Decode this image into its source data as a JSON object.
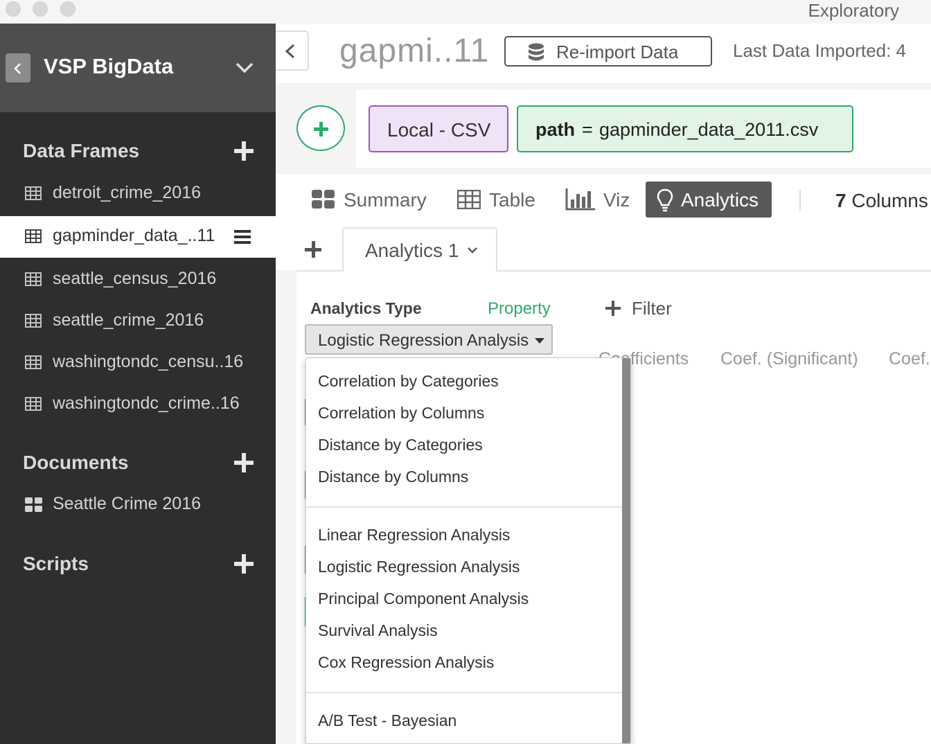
{
  "window": {
    "app_title": "Exploratory"
  },
  "sidebar": {
    "project_name": "VSP BigData",
    "sections": {
      "data_frames": "Data Frames",
      "documents": "Documents",
      "scripts": "Scripts"
    },
    "data_frames": [
      {
        "label": "detroit_crime_2016",
        "active": false
      },
      {
        "label": "gapminder_data_..11",
        "active": true
      },
      {
        "label": "seattle_census_2016",
        "active": false
      },
      {
        "label": "seattle_crime_2016",
        "active": false
      },
      {
        "label": "washingtondc_censu..16",
        "active": false
      },
      {
        "label": "washingtondc_crime..16",
        "active": false
      }
    ],
    "documents": [
      {
        "label": "Seattle Crime 2016"
      }
    ]
  },
  "header": {
    "dataframe_title": "gapmi..11",
    "reimport_label": "Re-import Data",
    "last_imported": "Last Data Imported: 4"
  },
  "steps": {
    "source": "Local - CSV",
    "path_key": "path",
    "path_eq": "=",
    "path_value": "gapminder_data_2011.csv"
  },
  "view_tabs": {
    "summary": "Summary",
    "table": "Table",
    "viz": "Viz",
    "analytics": "Analytics",
    "columns_count": "7",
    "columns_label": "Columns"
  },
  "analytics": {
    "tab_label": "Analytics 1",
    "type_label": "Analytics Type",
    "property_label": "Property",
    "filter_label": "Filter",
    "selected_type": "Logistic Regression Analysis",
    "result_tabs": [
      "Coefficients",
      "Coef. (Significant)",
      "Coef."
    ]
  },
  "dropdown": {
    "group1": [
      "Correlation by Categories",
      "Correlation by Columns",
      "Distance by Categories",
      "Distance by Columns"
    ],
    "group2": [
      "Linear Regression Analysis",
      "Logistic Regression Analysis",
      "Principal Component Analysis",
      "Survival Analysis",
      "Cox Regression Analysis"
    ],
    "group3": [
      "A/B Test - Bayesian"
    ]
  },
  "colors": {
    "sidebar_bg": "#2d2f2e",
    "accent_green": "#2eaa6a",
    "source_purple": "#9b59b6",
    "active_tab": "#595959"
  }
}
